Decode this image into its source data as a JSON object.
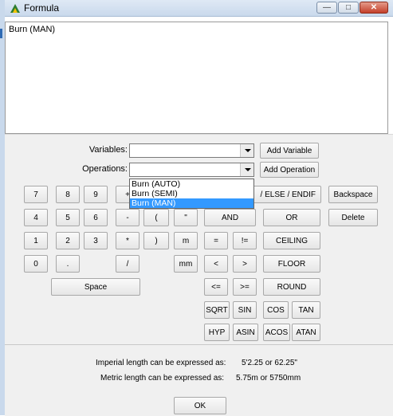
{
  "window": {
    "title": "Formula",
    "icon": "formula-app-icon",
    "controls": [
      "minimize-icon",
      "maximize-icon",
      "close-icon"
    ],
    "close_glyph": "✕",
    "minimize_glyph": "—",
    "maximize_glyph": "□"
  },
  "formula_text": "Burn (MAN)",
  "variables": {
    "label": "Variables:",
    "value": "",
    "add_label": "Add Variable"
  },
  "operations": {
    "label": "Operations:",
    "value": "",
    "add_label": "Add Operation",
    "options": [
      "Burn (AUTO)",
      "Burn (SEMI)",
      "Burn (MAN)"
    ],
    "selected_index": 2
  },
  "keys": {
    "k7": "7",
    "k8": "8",
    "k9": "9",
    "k4": "4",
    "k5": "5",
    "k6": "6",
    "k1": "1",
    "k2": "2",
    "k3": "3",
    "k0": "0",
    "dot": ".",
    "hidden_left": "+",
    "minus": "-",
    "lparen": "(",
    "quote": "\"",
    "times": "*",
    "rparen": ")",
    "m": "m",
    "divide": "/",
    "mm": "mm",
    "space": "Space",
    "if_else_partial": "/ ELSE / ENDIF",
    "and": "AND",
    "or": "OR",
    "eq": "=",
    "neq": "!=",
    "ceiling": "CEILING",
    "lt": "<",
    "gt": ">",
    "floor": "FLOOR",
    "le": "<=",
    "ge": ">=",
    "round": "ROUND",
    "sqrt": "SQRT",
    "sin": "SIN",
    "cos": "COS",
    "tan": "TAN",
    "hyp": "HYP",
    "asin": "ASIN",
    "acos": "ACOS",
    "atan": "ATAN",
    "backspace": "Backspace",
    "delete": "Delete"
  },
  "info": {
    "imperial_label": "Imperial length can be expressed as:",
    "imperial_value": "5'2.25 or 62.25\"",
    "metric_label": "Metric length can be expressed as:",
    "metric_value": "5.75m or 5750mm"
  },
  "ok_label": "OK"
}
